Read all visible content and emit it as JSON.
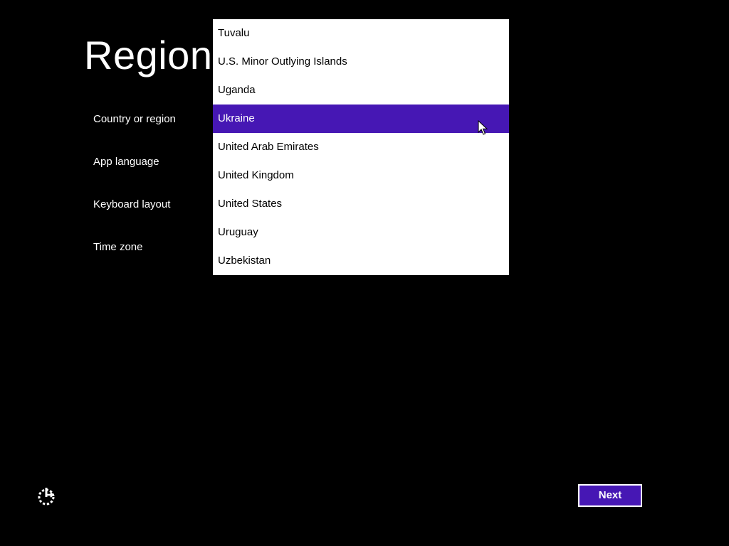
{
  "page": {
    "title": "Region"
  },
  "settings": {
    "country_label": "Country or region",
    "app_language_label": "App language",
    "keyboard_layout_label": "Keyboard layout",
    "time_zone_label": "Time zone"
  },
  "country_dropdown": {
    "items": [
      "Tuvalu",
      "U.S. Minor Outlying Islands",
      "Uganda",
      "Ukraine",
      "United Arab Emirates",
      "United Kingdom",
      "United States",
      "Uruguay",
      "Uzbekistan"
    ],
    "highlighted": "Ukraine"
  },
  "footer": {
    "ease_of_access_icon": "ease-of-access-icon",
    "next_label": "Next"
  },
  "colors": {
    "background": "#000000",
    "accent": "#4617b4",
    "dropdown_background": "#ffffff",
    "text_light": "#ffffff",
    "text_dark": "#000000"
  }
}
